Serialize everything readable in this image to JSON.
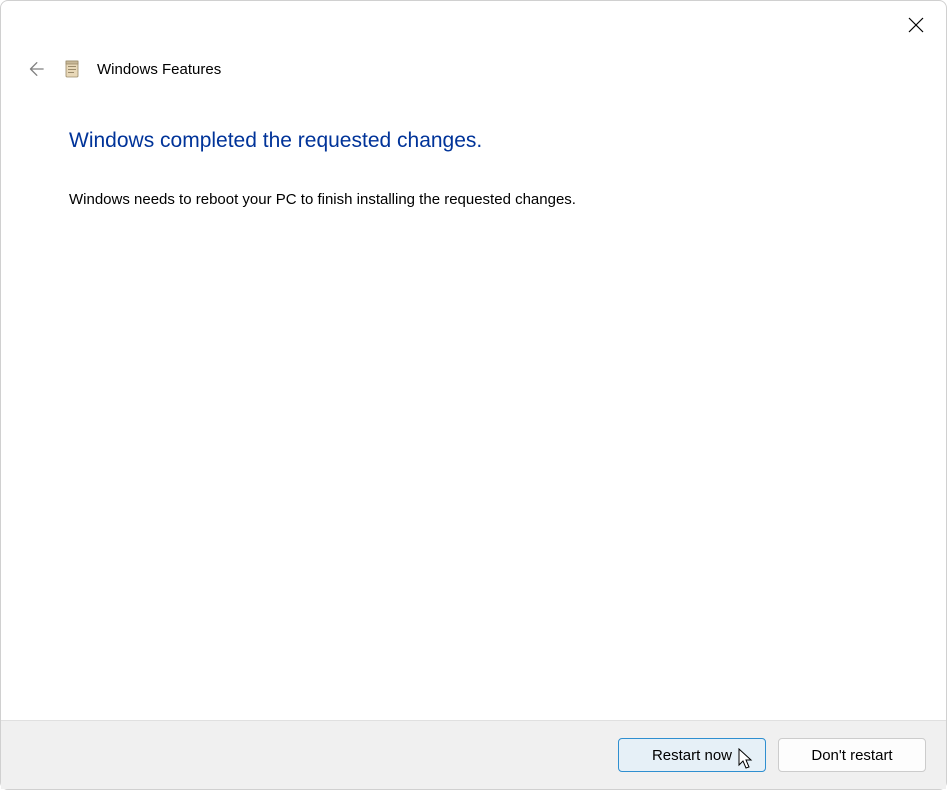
{
  "header": {
    "title": "Windows Features"
  },
  "content": {
    "heading": "Windows completed the requested changes.",
    "body": "Windows needs to reboot your PC to finish installing the requested changes."
  },
  "footer": {
    "primary_button": "Restart now",
    "secondary_button": "Don't restart"
  }
}
